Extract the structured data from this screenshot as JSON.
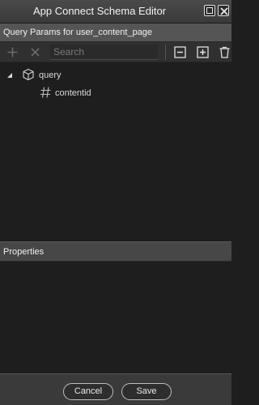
{
  "window": {
    "title": "App Connect Schema Editor",
    "maximize_icon": "maximize-icon",
    "close_icon": "close-icon"
  },
  "panel": {
    "title": "Query Params for user_content_page"
  },
  "toolbar": {
    "add_icon": "plus-icon",
    "remove_icon": "x-icon",
    "search_placeholder": "Search",
    "search_value": "",
    "collapse_icon": "minus-square-icon",
    "expand_icon": "plus-square-icon",
    "delete_icon": "trash-icon"
  },
  "tree": {
    "root": {
      "label": "query",
      "icon": "cube-icon",
      "expanded": true
    },
    "children": [
      {
        "label": "contentid",
        "icon": "hash-icon"
      }
    ]
  },
  "properties": {
    "title": "Properties"
  },
  "footer": {
    "cancel_label": "Cancel",
    "save_label": "Save"
  },
  "colors": {
    "titlebar": "#3f3f3f",
    "subheader": "#555555",
    "background": "#1e1e1e",
    "footer": "#3a3a3a"
  }
}
